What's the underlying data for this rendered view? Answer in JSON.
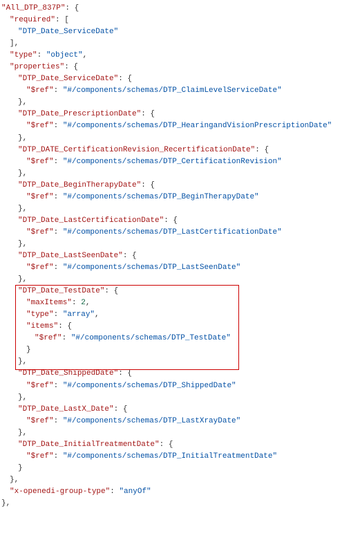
{
  "lines": [
    {
      "indent": 0,
      "parts": [
        {
          "t": "k",
          "s": "\"All_DTP_837P\""
        },
        {
          "t": "p",
          "s": ": {"
        }
      ]
    },
    {
      "indent": 1,
      "parts": [
        {
          "t": "k",
          "s": "\"required\""
        },
        {
          "t": "p",
          "s": ": ["
        }
      ]
    },
    {
      "indent": 2,
      "parts": [
        {
          "t": "v",
          "s": "\"DTP_Date_ServiceDate\""
        }
      ]
    },
    {
      "indent": 1,
      "parts": [
        {
          "t": "p",
          "s": "],"
        }
      ]
    },
    {
      "indent": 1,
      "parts": [
        {
          "t": "k",
          "s": "\"type\""
        },
        {
          "t": "p",
          "s": ": "
        },
        {
          "t": "v",
          "s": "\"object\""
        },
        {
          "t": "p",
          "s": ","
        }
      ]
    },
    {
      "indent": 1,
      "parts": [
        {
          "t": "k",
          "s": "\"properties\""
        },
        {
          "t": "p",
          "s": ": {"
        }
      ]
    },
    {
      "indent": 2,
      "parts": [
        {
          "t": "k",
          "s": "\"DTP_Date_ServiceDate\""
        },
        {
          "t": "p",
          "s": ": {"
        }
      ]
    },
    {
      "indent": 3,
      "parts": [
        {
          "t": "k",
          "s": "\"$ref\""
        },
        {
          "t": "p",
          "s": ": "
        },
        {
          "t": "v",
          "s": "\"#/components/schemas/DTP_ClaimLevelServiceDate\""
        }
      ]
    },
    {
      "indent": 2,
      "parts": [
        {
          "t": "p",
          "s": "},"
        }
      ]
    },
    {
      "indent": 2,
      "parts": [
        {
          "t": "k",
          "s": "\"DTP_Date_PrescriptionDate\""
        },
        {
          "t": "p",
          "s": ": {"
        }
      ]
    },
    {
      "indent": 3,
      "parts": [
        {
          "t": "k",
          "s": "\"$ref\""
        },
        {
          "t": "p",
          "s": ": "
        },
        {
          "t": "v",
          "s": "\"#/components/schemas/DTP_HearingandVisionPrescriptionDate\""
        }
      ]
    },
    {
      "indent": 2,
      "parts": [
        {
          "t": "p",
          "s": "},"
        }
      ]
    },
    {
      "indent": 2,
      "parts": [
        {
          "t": "k",
          "s": "\"DTP_DATE_CertificationRevision_RecertificationDate\""
        },
        {
          "t": "p",
          "s": ": {"
        }
      ]
    },
    {
      "indent": 3,
      "parts": [
        {
          "t": "k",
          "s": "\"$ref\""
        },
        {
          "t": "p",
          "s": ": "
        },
        {
          "t": "v",
          "s": "\"#/components/schemas/DTP_CertificationRevision\""
        }
      ]
    },
    {
      "indent": 2,
      "parts": [
        {
          "t": "p",
          "s": "},"
        }
      ]
    },
    {
      "indent": 2,
      "parts": [
        {
          "t": "k",
          "s": "\"DTP_Date_BeginTherapyDate\""
        },
        {
          "t": "p",
          "s": ": {"
        }
      ]
    },
    {
      "indent": 3,
      "parts": [
        {
          "t": "k",
          "s": "\"$ref\""
        },
        {
          "t": "p",
          "s": ": "
        },
        {
          "t": "v",
          "s": "\"#/components/schemas/DTP_BeginTherapyDate\""
        }
      ]
    },
    {
      "indent": 2,
      "parts": [
        {
          "t": "p",
          "s": "},"
        }
      ]
    },
    {
      "indent": 2,
      "parts": [
        {
          "t": "k",
          "s": "\"DTP_Date_LastCertificationDate\""
        },
        {
          "t": "p",
          "s": ": {"
        }
      ]
    },
    {
      "indent": 3,
      "parts": [
        {
          "t": "k",
          "s": "\"$ref\""
        },
        {
          "t": "p",
          "s": ": "
        },
        {
          "t": "v",
          "s": "\"#/components/schemas/DTP_LastCertificationDate\""
        }
      ]
    },
    {
      "indent": 2,
      "parts": [
        {
          "t": "p",
          "s": "},"
        }
      ]
    },
    {
      "indent": 2,
      "parts": [
        {
          "t": "k",
          "s": "\"DTP_Date_LastSeenDate\""
        },
        {
          "t": "p",
          "s": ": {"
        }
      ]
    },
    {
      "indent": 3,
      "parts": [
        {
          "t": "k",
          "s": "\"$ref\""
        },
        {
          "t": "p",
          "s": ": "
        },
        {
          "t": "v",
          "s": "\"#/components/schemas/DTP_LastSeenDate\""
        }
      ]
    },
    {
      "indent": 2,
      "parts": [
        {
          "t": "p",
          "s": "},"
        }
      ]
    },
    {
      "indent": 2,
      "parts": [
        {
          "t": "k",
          "s": "\"DTP_Date_TestDate\""
        },
        {
          "t": "p",
          "s": ": {"
        }
      ]
    },
    {
      "indent": 3,
      "parts": [
        {
          "t": "k",
          "s": "\"maxItems\""
        },
        {
          "t": "p",
          "s": ": "
        },
        {
          "t": "n",
          "s": "2"
        },
        {
          "t": "p",
          "s": ","
        }
      ]
    },
    {
      "indent": 3,
      "parts": [
        {
          "t": "k",
          "s": "\"type\""
        },
        {
          "t": "p",
          "s": ": "
        },
        {
          "t": "v",
          "s": "\"array\""
        },
        {
          "t": "p",
          "s": ","
        }
      ]
    },
    {
      "indent": 3,
      "parts": [
        {
          "t": "k",
          "s": "\"items\""
        },
        {
          "t": "p",
          "s": ": {"
        }
      ]
    },
    {
      "indent": 4,
      "parts": [
        {
          "t": "k",
          "s": "\"$ref\""
        },
        {
          "t": "p",
          "s": ": "
        },
        {
          "t": "v",
          "s": "\"#/components/schemas/DTP_TestDate\""
        }
      ]
    },
    {
      "indent": 3,
      "parts": [
        {
          "t": "p",
          "s": "}"
        }
      ]
    },
    {
      "indent": 2,
      "parts": [
        {
          "t": "p",
          "s": "},"
        }
      ]
    },
    {
      "indent": 2,
      "parts": [
        {
          "t": "k",
          "s": "\"DTP_Date_ShippedDate\""
        },
        {
          "t": "p",
          "s": ": {"
        }
      ]
    },
    {
      "indent": 3,
      "parts": [
        {
          "t": "k",
          "s": "\"$ref\""
        },
        {
          "t": "p",
          "s": ": "
        },
        {
          "t": "v",
          "s": "\"#/components/schemas/DTP_ShippedDate\""
        }
      ]
    },
    {
      "indent": 2,
      "parts": [
        {
          "t": "p",
          "s": "},"
        }
      ]
    },
    {
      "indent": 2,
      "parts": [
        {
          "t": "k",
          "s": "\"DTP_Date_LastX_Date\""
        },
        {
          "t": "p",
          "s": ": {"
        }
      ]
    },
    {
      "indent": 3,
      "parts": [
        {
          "t": "k",
          "s": "\"$ref\""
        },
        {
          "t": "p",
          "s": ": "
        },
        {
          "t": "v",
          "s": "\"#/components/schemas/DTP_LastXrayDate\""
        }
      ]
    },
    {
      "indent": 2,
      "parts": [
        {
          "t": "p",
          "s": "},"
        }
      ]
    },
    {
      "indent": 2,
      "parts": [
        {
          "t": "k",
          "s": "\"DTP_Date_InitialTreatmentDate\""
        },
        {
          "t": "p",
          "s": ": {"
        }
      ]
    },
    {
      "indent": 3,
      "parts": [
        {
          "t": "k",
          "s": "\"$ref\""
        },
        {
          "t": "p",
          "s": ": "
        },
        {
          "t": "v",
          "s": "\"#/components/schemas/DTP_InitialTreatmentDate\""
        }
      ]
    },
    {
      "indent": 2,
      "parts": [
        {
          "t": "p",
          "s": "}"
        }
      ]
    },
    {
      "indent": 1,
      "parts": [
        {
          "t": "p",
          "s": "},"
        }
      ]
    },
    {
      "indent": 1,
      "parts": [
        {
          "t": "k",
          "s": "\"x-openedi-group-type\""
        },
        {
          "t": "p",
          "s": ": "
        },
        {
          "t": "v",
          "s": "\"anyOf\""
        }
      ]
    },
    {
      "indent": 0,
      "parts": [
        {
          "t": "p",
          "s": "},"
        }
      ]
    }
  ],
  "highlight": {
    "startLine": 24,
    "endLine": 30
  }
}
